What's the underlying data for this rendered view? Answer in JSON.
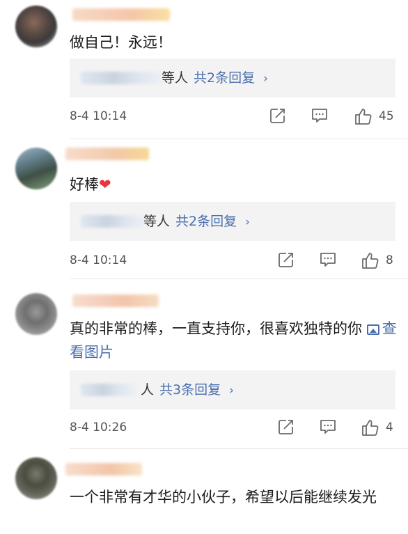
{
  "comments": [
    {
      "text": "做自己！永远！",
      "reply_suffix": "等人",
      "reply_count": "共2条回复",
      "reply_chevron": "›",
      "time": "8-4 10:14",
      "likes": "45"
    },
    {
      "text": "好棒",
      "emoji": "❤",
      "reply_suffix": "等人",
      "reply_count": "共2条回复",
      "reply_chevron": "›",
      "time": "8-4 10:14",
      "likes": "8"
    },
    {
      "text": "真的非常的棒，一直支持你，很喜欢独特的你",
      "image_link": "查看图片",
      "reply_suffix": "人",
      "reply_count": "共3条回复",
      "reply_chevron": "›",
      "time": "8-4 10:26",
      "likes": "4"
    },
    {
      "text": "一个非常有才华的小伙子，希望以后能继续发光"
    }
  ],
  "icons": {
    "repost": "repost-icon",
    "comment": "comment-icon",
    "like": "thumbs-up-icon",
    "image": "image-icon"
  },
  "colors": {
    "link": "#4a6fae",
    "reply_bg": "#f3f3f3",
    "heart": "#e8343b"
  }
}
